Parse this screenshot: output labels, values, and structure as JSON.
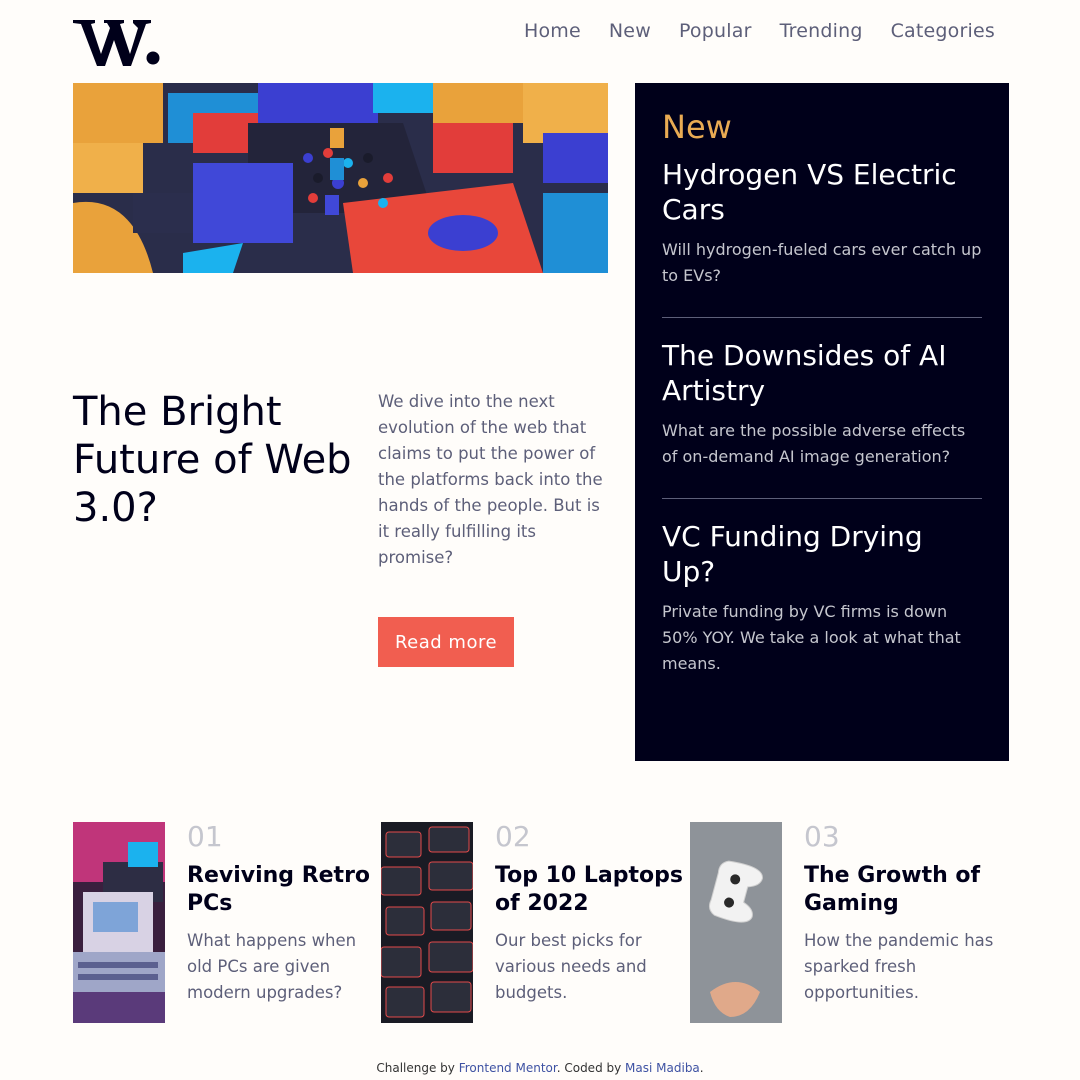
{
  "brand": {
    "logo_text": "W."
  },
  "nav": {
    "items": [
      {
        "label": "Home"
      },
      {
        "label": "New"
      },
      {
        "label": "Popular"
      },
      {
        "label": "Trending"
      },
      {
        "label": "Categories"
      }
    ]
  },
  "hero": {
    "title": "The Bright Future of Web 3.0?",
    "description": "We dive into the next evolution of the web that claims to put the power of the platforms back into the hands of the people. But is it really fulfilling its promise?",
    "button_label": "Read more"
  },
  "new_panel": {
    "heading": "New",
    "items": [
      {
        "title": "Hydrogen VS Electric Cars",
        "summary": "Will hydrogen-fueled cars ever catch up to EVs?"
      },
      {
        "title": "The Downsides of AI Artistry",
        "summary": "What are the possible adverse effects of on-demand AI image generation?"
      },
      {
        "title": "VC Funding Drying Up?",
        "summary": "Private funding by VC firms is down 50% YOY. We take a look at what that means."
      }
    ]
  },
  "cards": [
    {
      "number": "01",
      "title": "Reviving Retro PCs",
      "summary": "What happens when old PCs are given modern upgrades?"
    },
    {
      "number": "02",
      "title": "Top 10 Laptops of 2022",
      "summary": "Our best picks for various needs and budgets."
    },
    {
      "number": "03",
      "title": "The Growth of Gaming",
      "summary": "How the pandemic has sparked fresh opportunities."
    }
  ],
  "footer": {
    "prefix": "Challenge by ",
    "link1": "Frontend Mentor",
    "middle": ". Coded by ",
    "link2": "Masi Madiba",
    "suffix": "."
  },
  "colors": {
    "background": "#fffdfa",
    "dark": "#00001a",
    "accent_red": "#f15e50",
    "accent_orange": "#e9ab53",
    "gray_blue": "#5d5f79"
  }
}
